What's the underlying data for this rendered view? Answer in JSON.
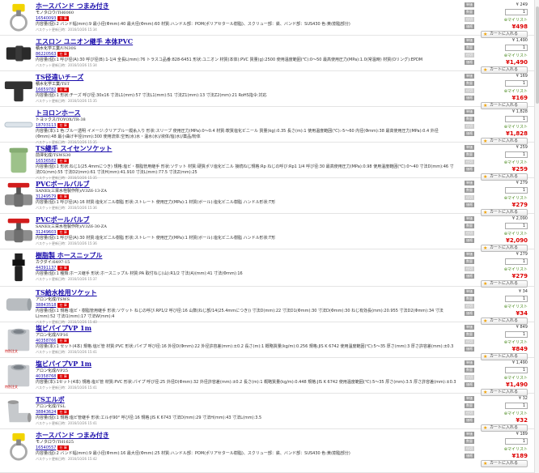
{
  "labels": {
    "tanka": "単価",
    "suryo": "数量",
    "shikiri": "仕切",
    "kakaku": "価格",
    "zaiko": "在 庫",
    "mylist": "マイリスト",
    "cart": "カートに入れる",
    "pc_badge": "特別注文"
  },
  "products": [
    {
      "title": "ホースバンド つまみ付き",
      "maker": "モノタロウ/TH6060",
      "code": "16540093",
      "list_price": "¥ 249",
      "qty": "1",
      "net_price": "¥498",
      "spec": "内容量(個):2 バンド幅(mm):9 最小径(Φmm):40 最大径(Φmm):60 材質:ハンドル部：POM(ポリアセタール樹脂)、スクリュー部：鉄、バンド部：SUS430 色:黄(樹脂部分)",
      "updated": "バスケット更新日時：2016/10/26 15:34",
      "img": "clamp"
    },
    {
      "title": "エスロン ユニオン継手 本体PVC",
      "maker": "積水化学工業/UN30S",
      "code": "86220563",
      "list_price": "¥ 1,490",
      "qty": "1",
      "net_price": "¥1,490",
      "spec": "内容量(個):1 呼び径(A):30 呼び径(B):1-1/4 全長L(mm):76 トラスコ品番:828-6451 形状:ユニオン 材質(本体):PVC 質量(g):2500 使用温度範囲(℃):0〜50 最高使用圧力(MPa):1.0(常温時) 材質(Oリング):EPDM",
      "updated": "バスケット更新日時：2016/10/26 15:34",
      "img": "union"
    },
    {
      "title": "TS径違いチーズ",
      "maker": "積水化学工業/TST",
      "code": "16659782",
      "list_price": "¥ 169",
      "qty": "1",
      "net_price": "¥169",
      "spec": "内容量(個):1 形状:チーズ 呼び径:30x16 寸法L1(mm):57 寸法L1(mm):51 寸法Z1(mm):13 寸法Z2(mm):21 RoHS指令:対応",
      "updated": "バスケット更新日時：2016/10/26 15:35",
      "img": "tee"
    },
    {
      "title": "トヨロンホース",
      "maker": "トヨックス/TOYOX/TR-38",
      "code": "18703113",
      "list_price": "¥ 1,828",
      "qty": "1",
      "net_price": "¥1,828",
      "spec": "内容量(本):1 色:ブルー透明 イメージ:クリアブルー縦糸入り 形状:スリーブ 使用圧力(MPa):0〜0.4 材質:軟質塩化ビニール 質量(kg):0.35 長さ(m):1 使用温度範囲(℃):-5〜60 内径(Φmm):38 最高使用圧力(MPa):0.4 外径(Φmm):48 最小曲げ半径(mm):300 使用流体:空気(水)水・温水(水)/液体/塩(水)/薬品/粉体",
      "updated": "バスケット更新日時：2016/10/26 15:35",
      "img": "hose"
    },
    {
      "title": "TS継手 スイセンソケット",
      "maker": "前澤化成/TSWS30",
      "code": "16536582",
      "list_price": "¥ 259",
      "qty": "1",
      "net_price": "¥259",
      "spec": "内容量(個):1 形状:ねじ1(25.4mmにつき) 規格:塩ビ・樹脂管用継手 形状:ソケット 材質:硬質ポリ塩化ビニル 接続ねじ規格:Rp ねじの呼び:Rp1 1/4 呼び径:30 最高使用圧力(MPa):0.98 使用温度範囲(℃):0〜40 寸法D(mm):46 寸法D1(mm):55 寸法D2(mm):61 寸法H(mm):41.910 寸法L(mm):77.5 寸法Z(mm):25",
      "updated": "バスケット更新日時：2016/10/26 15:35",
      "img": "socket"
    },
    {
      "title": "PVCボールバルブ",
      "maker": "SANEI(三栄水栓製作所)/V3Z6-13-ZA",
      "code": "31249579",
      "list_price": "¥ 279",
      "qty": "1",
      "net_price": "¥279",
      "spec": "内容量(個):1 呼び径(A):16 材質:塩化ビニル樹脂 形状:ストレート 使用圧力(MPa):1 材質(ボール):塩化ビニル樹脂 ハンドル形状:T形",
      "updated": "バスケット更新日時：2016/10/26 15:36",
      "img": "valve"
    },
    {
      "title": "PVCボールバルブ",
      "maker": "SANEI(三栄水栓製作所)/V3Z6-30-ZA",
      "code": "31249603",
      "list_price": "¥ 2,090",
      "qty": "1",
      "net_price": "¥2,090",
      "spec": "内容量(個):1 呼び径(A):30 材質:塩化ビニル樹脂 形状:ストレート 使用圧力(MPa):1 材質(ボール):塩化ビニル樹脂 ハンドル形状:T形",
      "updated": "バスケット更新日時：2016/10/26 15:36",
      "img": "valve"
    },
    {
      "title": "樹脂製 ホースニップル",
      "maker": "カクダイ/6497-15",
      "code": "44391137",
      "list_price": "¥ 279",
      "qty": "1",
      "net_price": "¥279",
      "spec": "内容量(個):1 種類:ホース継手 形状:ホースニップル 材質:PA 取付ねじ(山):R1/2 寸法(A)(mm):41 寸法(Φmm):16",
      "updated": "バスケット更新日時：2016/10/26 15:37",
      "img": "nipple"
    },
    {
      "title": "TS給水栓用ソケット",
      "maker": "アロン化成/TSWS",
      "code": "38843518",
      "list_price": "¥ 34",
      "qty": "1",
      "net_price": "¥34",
      "spec": "内容量(個):1 規格:塩ビ・樹脂管用継手 形状:ソケット ねじの呼び:RP1/2 呼び径:16 山数(ねじ部/14(25.4mmにつき)) 寸法D(mm):22 寸法D1(Φmm):30 寸法D(Φmm):30 ねじ有効長(mm):20.955 寸法D2(Φmm):34 寸法L(mm):52 寸法I1(mm):17 寸法W(mm):4",
      "updated": "バスケット更新日時：2016/10/26 15:40",
      "img": "socket2"
    },
    {
      "title": "塩ビパイプVP 1m",
      "maker": "アロン化成/VP16",
      "code": "40358766",
      "list_price": "¥ 849",
      "qty": "1",
      "net_price": "¥849",
      "spec": "内容量(本):1 セット(4本) 規格:塩ビ管 材質:PVC 形状:パイプ 呼び径:16 外径D(Φmm):22 外径許容差(mm):±0.2 長さ(m):1 概略質量(kg/m):0.256 規格:JIS K 6742 使用温度範囲(℃):5〜35 厚さ(mm):3 厚さ許容差(mm):±0.3",
      "updated": "バスケット更新日時：2016/10/26 15:41",
      "img": "pipe",
      "special": true
    },
    {
      "title": "塩ビパイプVP 1m",
      "maker": "アロン化成/VP25",
      "code": "40358768",
      "list_price": "¥ 1,490",
      "qty": "1",
      "net_price": "¥1,490",
      "spec": "内容量(本):1セット(4本) 規格:塩ビ管 材質:PVC 形状:パイプ 呼び径:25 外径D(Φmm):32 外径許容差(mm):±0.2 長さ(m):1 概略質量(kg/m):0.448 規格:JIS K 6742 使用温度範囲(℃):5〜35 厚さ(mm):3.5 厚さ許容差(mm):±0.3",
      "updated": "バスケット更新日時：2016/10/26 15:41",
      "img": "pipe",
      "special": true
    },
    {
      "title": "TSエルボ",
      "maker": "アロン化成/TSL",
      "code": "38843624",
      "list_price": "¥ 32",
      "qty": "1",
      "net_price": "¥32",
      "spec": "内容量(個):1 規格:塩ビ管継手 形状:エルボ90° 呼び径:16 規格:JIS K 6743 寸法D(mm):29 寸法H(mm):43 寸法L(mm):3.5",
      "updated": "バスケット更新日時：2016/10/26 15:41",
      "img": "elbow"
    },
    {
      "title": "ホースバンド つまみ付き",
      "maker": "モノタロウ/TH1625",
      "code": "16540557",
      "list_price": "¥ 189",
      "qty": "1",
      "net_price": "¥189",
      "spec": "内容量(個):2 バンド幅(mm):9 最小径(Φmm):16 最大径(Φmm):25 材質:ハンドル部：POM(ポリアセタール樹脂)、スクリュー部：鉄、バンド部：SUS430 色:黄(樹脂部分)",
      "updated": "バスケット更新日時：2016/10/26 15:42",
      "img": "clamp"
    }
  ]
}
